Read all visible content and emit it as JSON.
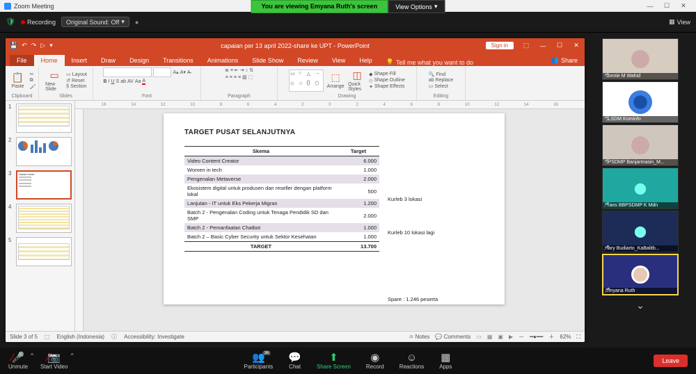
{
  "zoom": {
    "window_title": "Zoom Meeting",
    "share_banner": "You are viewing Emyana Ruth's screen",
    "view_options": "View Options",
    "recording": "Recording",
    "sound_pill": "Original Sound: Off",
    "view_btn": "View"
  },
  "ppt": {
    "title": "capaian per 13 april 2022-share ke UPT  -  PowerPoint",
    "signin": "Sign in",
    "tabs": {
      "file": "File",
      "home": "Home",
      "insert": "Insert",
      "draw": "Draw",
      "design": "Design",
      "transitions": "Transitions",
      "animations": "Animations",
      "slideshow": "Slide Show",
      "review": "Review",
      "view": "View",
      "help": "Help",
      "tell": "Tell me what you want to do",
      "share": "Share"
    },
    "ribbon": {
      "paste": "Paste",
      "clipboard": "Clipboard",
      "newslide": "New Slide",
      "layout": "Layout",
      "reset": "Reset",
      "section": "Section",
      "slides": "Slides",
      "font_group": "Font",
      "para": "Paragraph",
      "arrange": "Arrange",
      "quick": "Quick Styles",
      "shapefill": "Shape Fill",
      "shapeoutline": "Shape Outline",
      "shapeeffects": "Shape Effects",
      "drawing": "Drawing",
      "find": "Find",
      "replace": "Replace",
      "select": "Select",
      "editing": "Editing"
    },
    "status": {
      "slide": "Slide 3 of 5",
      "lang": "English (Indonesia)",
      "access": "Accessibility: Investigate",
      "notes": "Notes",
      "comments": "Comments",
      "zoom": "62%"
    }
  },
  "slide": {
    "title": "TARGET PUSAT SELANJUTNYA",
    "head_scheme": "Skema",
    "head_target": "Target",
    "rows": [
      {
        "s": "Video Content Creator",
        "t": "6.000",
        "alt": true
      },
      {
        "s": "Women in tech",
        "t": "1.000",
        "alt": false
      },
      {
        "s": "Pengenalan Metaverse",
        "t": "2.000",
        "alt": true
      },
      {
        "s": "Ekosistem digital untuk produsen dan reseller dengan platform lokal",
        "t": "500",
        "alt": false
      },
      {
        "s": "Lanjutan - IT untuk Eks Pekerja Migran",
        "t": "1.200",
        "alt": true
      },
      {
        "s": "Batch 2 - Pengenalan Coding untuk Tenaga Pendidik SD dan SMP",
        "t": "2.000",
        "alt": false
      },
      {
        "s": "Batch 2 - Pemanfaatan Chatbot",
        "t": "1.000",
        "alt": true
      },
      {
        "s": "Batch 2 – Basic Cyber Security untuk Sektor Kesehatan",
        "t": "1.000",
        "alt": false
      }
    ],
    "total_label": "TARGET",
    "total_val": "13.700",
    "side_notes": [
      "",
      "",
      "",
      "Kurleb 3 lokasi",
      "",
      "Kurleb 10 lokasi lagi",
      "",
      "",
      "",
      "Spare : 1.246 peserta"
    ]
  },
  "thumbs": [
    "1",
    "2",
    "3",
    "4",
    "5"
  ],
  "participants": [
    {
      "name": "Bonnie M Wahid",
      "bg": "#d7ccc0"
    },
    {
      "name": "BLSDM Kominfo",
      "bg": "#ffffff"
    },
    {
      "name": "BPSDMP Banjarmasin_M...",
      "bg": "#cfc7bd"
    },
    {
      "name": "Frans BBPSDMP K Mdn",
      "bg": "#1ea8a0"
    },
    {
      "name": "Hary Budiarto_KaBalitb...",
      "bg": "#1d2b57"
    },
    {
      "name": "Emyana Ruth",
      "bg": "#2a2f7d"
    }
  ],
  "controls": {
    "unmute": "Unmute",
    "video": "Start Video",
    "participants": "Participants",
    "pcount": "36",
    "chat": "Chat",
    "share": "Share Screen",
    "record": "Record",
    "reactions": "Reactions",
    "apps": "Apps",
    "leave": "Leave"
  },
  "chart_data": {
    "type": "table",
    "title": "TARGET PUSAT SELANJUTNYA",
    "columns": [
      "Skema",
      "Target"
    ],
    "rows": [
      [
        "Video Content Creator",
        6000
      ],
      [
        "Women in tech",
        1000
      ],
      [
        "Pengenalan Metaverse",
        2000
      ],
      [
        "Ekosistem digital untuk produsen dan reseller dengan platform lokal",
        500
      ],
      [
        "Lanjutan - IT untuk Eks Pekerja Migran",
        1200
      ],
      [
        "Batch 2 - Pengenalan Coding untuk Tenaga Pendidik SD dan SMP",
        2000
      ],
      [
        "Batch 2 - Pemanfaatan Chatbot",
        1000
      ],
      [
        "Batch 2 – Basic Cyber Security untuk Sektor Kesehatan",
        1000
      ]
    ],
    "total": [
      "TARGET",
      13700
    ],
    "annotations": [
      "Kurleb 3 lokasi",
      "Kurleb 10 lokasi lagi",
      "Spare : 1.246 peserta"
    ]
  }
}
